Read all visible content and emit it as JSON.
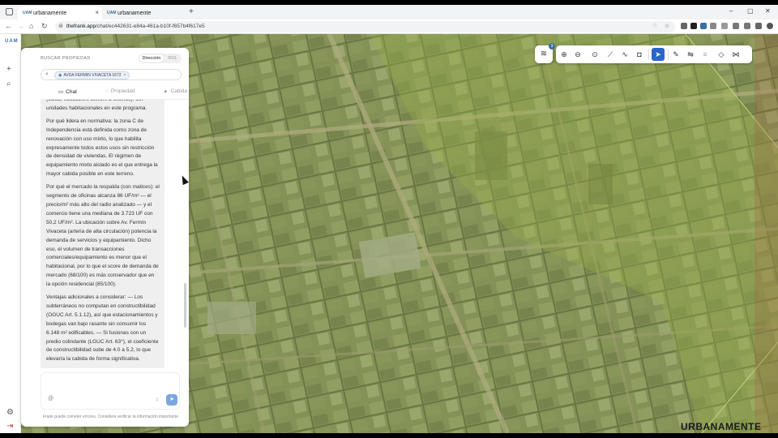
{
  "browser": {
    "tabs": [
      {
        "label": "urbanamente",
        "favicon": "UAM",
        "active": true
      },
      {
        "label": "urbanamente",
        "favicon": "UAM",
        "active": false
      }
    ],
    "url_domain": "thefrank.app",
    "url_path": "/chat/ec442631-e84a-461a-b10f-f657b4f617e5"
  },
  "rail": {
    "logo": "UAM"
  },
  "panel": {
    "title": "BUSCAR PROPIEDAD",
    "toggle": {
      "selected": "Dirección",
      "other": "ROL"
    },
    "search_chip": "AVDA FERMIN VIVACETA 1672",
    "tabs": [
      {
        "label": "Chat",
        "icon": "chat-icon",
        "active": true
      },
      {
        "label": "Propiedad",
        "icon": "property-icon",
        "active": false
      },
      {
        "label": "Cabida",
        "icon": "capacity-icon",
        "active": false
      }
    ],
    "message_paragraphs": [
      "(salud, educación, cowork u oficinas). Sin unidades habitacionales en este programa.",
      "Por qué lidera en normativa: la zona C de Independencia está definida como zona de renovación con uso mixto, lo que habilita expresamente todos estos usos sin restricción de densidad de viviendas. El régimen de equipamiento mixto aislado es el que entrega la mayor cabida posible en este terreno.",
      "Por qué el mercado la respalda (con matices): el segmento de oficinas alcanza 86 UF/m² — el precio/m² más alto del radio analizado — y el comercio tiene una mediana de 3.723 UF con 50,2 UF/m². La ubicación sobre Av. Fermín Vivaceta (arteria de alta circulación) potencia la demanda de servicios y equipamiento. Dicho eso, el volumen de transacciones comerciales/equipamiento es menor que el habitacional, por lo que el score de demanda de mercado (68/100) es más conservador que en la opción residencial (85/100).",
      "Ventajas adicionales a considerar: — Los subterráneos no computan en constructibilidad (OGUC Art. 5.1.12), así que estacionamientos y bodegas van bajo rasante sin consumir los 6.148 m² edificables. — Si fusionas con un predio colindante (LGUC Art. 63°), el coeficiente de constructibilidad sube de 4.0 a 5.2, lo que elevaría la cabida de forma significativa."
    ],
    "composer_at": "@",
    "disclaimer": "Frank puede cometer errores. Considera verificar la información importante."
  },
  "map": {
    "layers_badge": "3",
    "overlay_color": "#9bb24a",
    "toolbar_icons": [
      "zoom-in-icon",
      "zoom-out-icon",
      "pin-icon",
      "ruler-icon",
      "path-icon",
      "camera-icon",
      "select-icon",
      "pencil-icon",
      "route-icon",
      "hatch-icon",
      "eraser-icon",
      "share-icon"
    ]
  },
  "brand": "URBANAMENTE"
}
